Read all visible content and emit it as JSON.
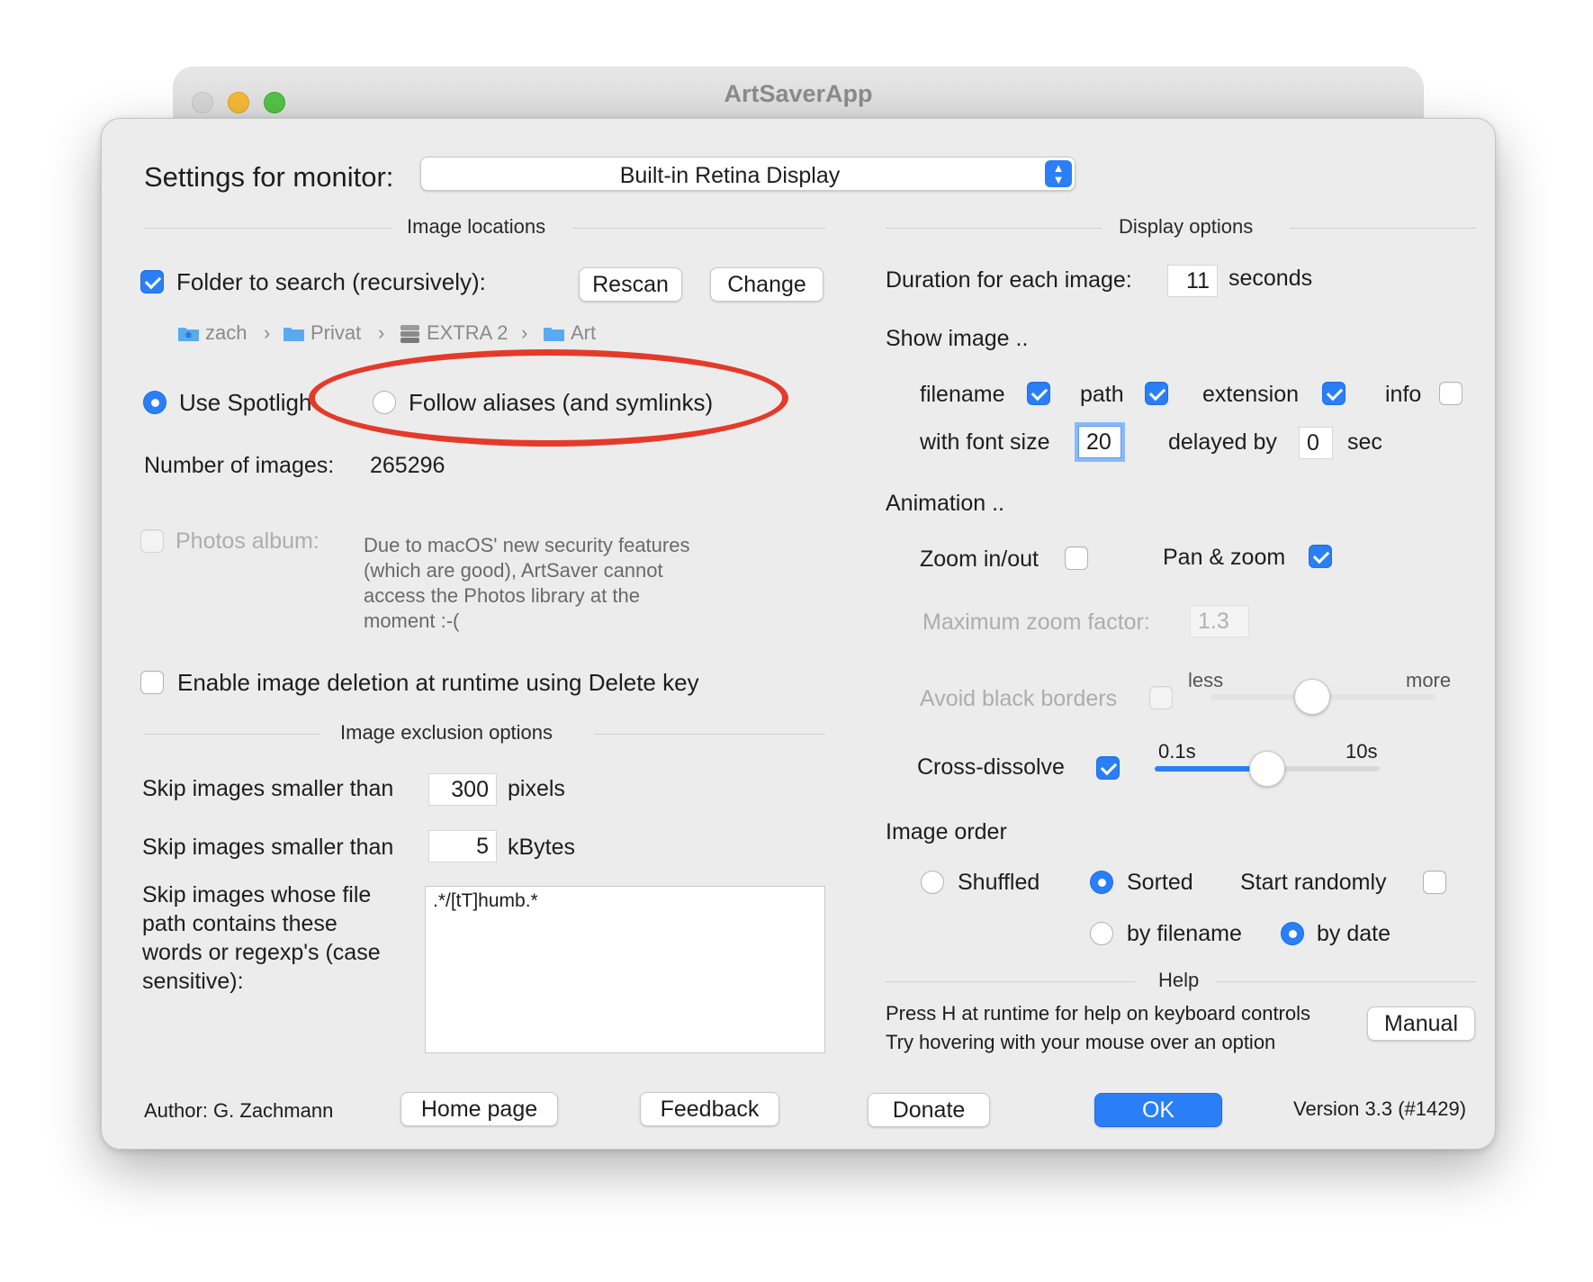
{
  "window": {
    "title": "ArtSaverApp"
  },
  "monitor": {
    "label": "Settings for monitor:",
    "selected": "Built-in Retina Display"
  },
  "image_locations": {
    "header": "Image locations",
    "folder_label": "Folder to search (recursively):",
    "folder_checked": true,
    "rescan_label": "Rescan",
    "change_label": "Change",
    "breadcrumb": [
      {
        "label": "zach",
        "icon": "home-folder-icon"
      },
      {
        "label": "Privat",
        "icon": "folder-icon"
      },
      {
        "label": "EXTRA 2",
        "icon": "disk-icon"
      },
      {
        "label": "Art",
        "icon": "folder-icon"
      }
    ],
    "breadcrumb_sep": "›",
    "use_spotlight_label": "Use Spotligh",
    "use_spotlight_selected": true,
    "follow_aliases_label": "Follow aliases (and symlinks)",
    "follow_aliases_selected": false,
    "num_images_label": "Number of images:",
    "num_images_value": "265296",
    "photos_label": "Photos album:",
    "photos_note": "Due to macOS' new security features (which are good), ArtSaver cannot access the Photos library at the moment :-(",
    "enable_deletion_label": "Enable image deletion at runtime using Delete key"
  },
  "exclusion": {
    "header": "Image exclusion options",
    "skip_pixels_label": "Skip images smaller than",
    "skip_pixels_value": "300",
    "skip_pixels_unit": "pixels",
    "skip_kb_label": "Skip images smaller than",
    "skip_kb_value": "5",
    "skip_kb_unit": "kBytes",
    "regexp_label_lines": [
      "Skip images whose file",
      "path contains these",
      "words or regexp's (case",
      "sensitive):"
    ],
    "regexp_value": ".*/[tT]humb.*"
  },
  "display": {
    "header": "Display options",
    "duration_label": "Duration for each image:",
    "duration_value": "11",
    "duration_unit": "seconds",
    "show_image_label": "Show image ..",
    "filename_label": "filename",
    "filename_checked": true,
    "path_label": "path",
    "path_checked": true,
    "extension_label": "extension",
    "extension_checked": true,
    "info_label": "info",
    "info_checked": false,
    "font_size_label": "with font size",
    "font_size_value": "20",
    "delayed_label": "delayed by",
    "delayed_value": "0",
    "delayed_unit": "sec",
    "animation_label": "Animation ..",
    "zoom_label": "Zoom in/out",
    "zoom_checked": false,
    "panzoom_label": "Pan & zoom",
    "panzoom_checked": true,
    "max_zoom_label": "Maximum zoom factor:",
    "max_zoom_value": "1.3",
    "avoid_borders_label": "Avoid black borders",
    "less_label": "less",
    "more_label": "more",
    "avoid_borders_slider_fraction": 0.45,
    "cross_dissolve_label": "Cross-dissolve",
    "cross_dissolve_checked": true,
    "dissolve_min_label": "0.1s",
    "dissolve_max_label": "10s",
    "dissolve_slider_fraction": 0.5,
    "image_order_label": "Image order",
    "shuffled_label": "Shuffled",
    "shuffled_selected": false,
    "sorted_label": "Sorted",
    "sorted_selected": true,
    "start_randomly_label": "Start randomly",
    "start_randomly_checked": false,
    "by_filename_label": "by filename",
    "by_filename_selected": false,
    "by_date_label": "by date",
    "by_date_selected": true
  },
  "help": {
    "header": "Help",
    "line1": "Press H at runtime for help on keyboard controls",
    "line2": "Try hovering with your mouse over an option",
    "manual_label": "Manual"
  },
  "footer": {
    "author": "Author: G. Zachmann",
    "home_label": "Home page",
    "feedback_label": "Feedback",
    "donate_label": "Donate",
    "ok_label": "OK",
    "version": "Version 3.3 (#1429)"
  },
  "colors": {
    "accent": "#2a7ff7",
    "annotation": "#e53a2a",
    "window_bg": "#ececec"
  }
}
